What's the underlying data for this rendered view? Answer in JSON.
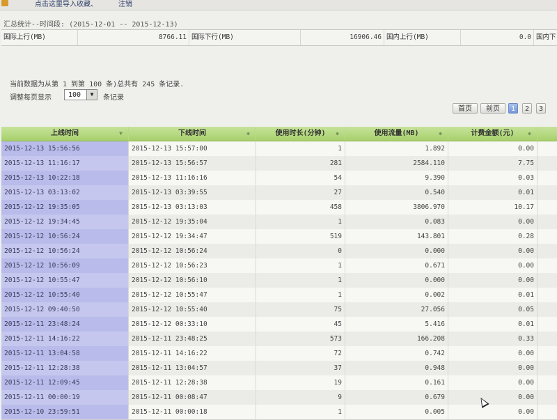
{
  "topbar": {
    "link1": "点击这里导入收藏、",
    "link2": "注销"
  },
  "summary": {
    "title": "汇总统计--时间段: (2015-12-01 -- 2015-12-13)",
    "cells": [
      {
        "label": "国际上行(MB)",
        "value": "8766.11"
      },
      {
        "label": "国际下行(MB)",
        "value": "16906.46"
      },
      {
        "label": "国内上行(MB)",
        "value": "0.0"
      },
      {
        "label": "国内下",
        "value": ""
      }
    ]
  },
  "records_info": "当前数据为从第 1 到第 100 条)总共有 245 条记录.",
  "page_size": {
    "label": "调整每页显示",
    "value": "100",
    "suffix": "条记录"
  },
  "pager": {
    "first": "首页",
    "prev": "前页",
    "pages": [
      "1",
      "2",
      "3"
    ],
    "active": "1"
  },
  "table": {
    "headers": [
      "上线时间",
      "下线时间",
      "使用时长(分钟)",
      "使用流量(MB)",
      "计费金额(元)"
    ],
    "rows": [
      [
        "2015-12-13 15:56:56",
        "2015-12-13 15:57:00",
        "1",
        "1.892",
        "0.00"
      ],
      [
        "2015-12-13 11:16:17",
        "2015-12-13 15:56:57",
        "281",
        "2584.110",
        "7.75"
      ],
      [
        "2015-12-13 10:22:18",
        "2015-12-13 11:16:16",
        "54",
        "9.390",
        "0.03"
      ],
      [
        "2015-12-13 03:13:02",
        "2015-12-13 03:39:55",
        "27",
        "0.540",
        "0.01"
      ],
      [
        "2015-12-12 19:35:05",
        "2015-12-13 03:13:03",
        "458",
        "3806.970",
        "10.17"
      ],
      [
        "2015-12-12 19:34:45",
        "2015-12-12 19:35:04",
        "1",
        "0.083",
        "0.00"
      ],
      [
        "2015-12-12 10:56:24",
        "2015-12-12 19:34:47",
        "519",
        "143.801",
        "0.28"
      ],
      [
        "2015-12-12 10:56:24",
        "2015-12-12 10:56:24",
        "0",
        "0.000",
        "0.00"
      ],
      [
        "2015-12-12 10:56:09",
        "2015-12-12 10:56:23",
        "1",
        "0.671",
        "0.00"
      ],
      [
        "2015-12-12 10:55:47",
        "2015-12-12 10:56:10",
        "1",
        "0.000",
        "0.00"
      ],
      [
        "2015-12-12 10:55:40",
        "2015-12-12 10:55:47",
        "1",
        "0.002",
        "0.01"
      ],
      [
        "2015-12-12 09:40:50",
        "2015-12-12 10:55:40",
        "75",
        "27.056",
        "0.05"
      ],
      [
        "2015-12-11 23:48:24",
        "2015-12-12 00:33:10",
        "45",
        "5.416",
        "0.01"
      ],
      [
        "2015-12-11 14:16:22",
        "2015-12-11 23:48:25",
        "573",
        "166.208",
        "0.33"
      ],
      [
        "2015-12-11 13:04:58",
        "2015-12-11 14:16:22",
        "72",
        "0.742",
        "0.00"
      ],
      [
        "2015-12-11 12:28:38",
        "2015-12-11 13:04:57",
        "37",
        "0.948",
        "0.00"
      ],
      [
        "2015-12-11 12:09:45",
        "2015-12-11 12:28:38",
        "19",
        "0.161",
        "0.00"
      ],
      [
        "2015-12-11 00:00:19",
        "2015-12-11 00:08:47",
        "9",
        "0.679",
        "0.00"
      ],
      [
        "2015-12-10 23:59:51",
        "2015-12-11 00:00:18",
        "1",
        "0.005",
        "0.00"
      ]
    ]
  }
}
